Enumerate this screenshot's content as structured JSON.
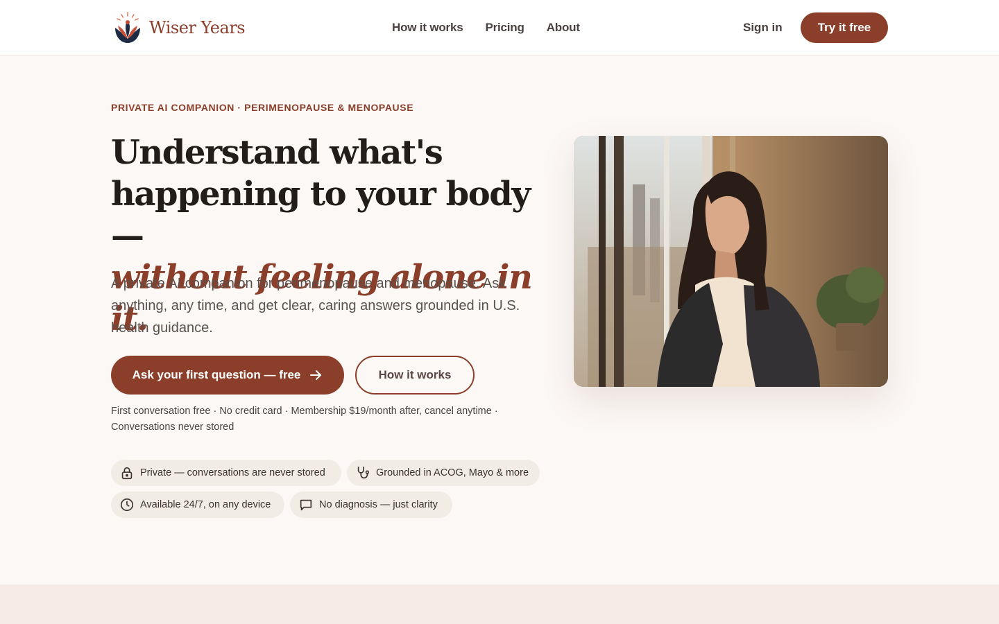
{
  "brand": {
    "name": "Wiser Years"
  },
  "nav": {
    "links": [
      "How it works",
      "Pricing",
      "About"
    ],
    "signin": "Sign in",
    "cta": "Try it free"
  },
  "hero": {
    "eyebrow": "PRIVATE AI COMPANION · PERIMENOPAUSE & MENOPAUSE",
    "headline_line1": "Understand what's",
    "headline_line2": "happening to your body —",
    "headline_accent": "without feeling alone in it.",
    "lead": "A private AI companion for perimenopause and menopause. Ask anything, any time, and get clear, caring answers grounded in U.S. health guidance.",
    "primary_cta": "Ask your first question — free",
    "secondary_cta": "How it works",
    "fineprint": "First conversation free · No credit card · Membership $19/month after, cancel anytime · Conversations never stored"
  },
  "features": [
    {
      "icon": "lock-icon",
      "label": "Private — conversations are never stored"
    },
    {
      "icon": "stethoscope-icon",
      "label": "Grounded in ACOG, Mayo & more"
    },
    {
      "icon": "clock-icon",
      "label": "Available 24/7, on any device"
    },
    {
      "icon": "chat-bubble-icon",
      "label": "No diagnosis — just clarity"
    }
  ],
  "colors": {
    "accent": "#8b3f2a",
    "background": "#fcf8f6",
    "pill": "#f1ede5"
  }
}
